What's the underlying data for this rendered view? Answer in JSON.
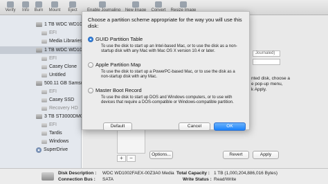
{
  "toolbar": {
    "items": [
      {
        "label": "Verify"
      },
      {
        "label": "Info"
      },
      {
        "label": "Burn"
      },
      {
        "label": "Mount"
      },
      {
        "label": "Eject"
      },
      {
        "label": "Enable Journaling"
      },
      {
        "label": "New Image"
      },
      {
        "label": "Convert"
      },
      {
        "label": "Resize Image"
      }
    ]
  },
  "sidebar": {
    "items": [
      {
        "label": "1 TB WDC WD100",
        "kind": "disk"
      },
      {
        "label": "EFI",
        "kind": "volume",
        "dim": true
      },
      {
        "label": "Media Libraries",
        "kind": "volume"
      },
      {
        "label": "1 TB WDC WD100",
        "kind": "disk",
        "selected": true
      },
      {
        "label": "EFI",
        "kind": "volume",
        "dim": true
      },
      {
        "label": "Casey Clone",
        "kind": "volume"
      },
      {
        "label": "Untitled",
        "kind": "volume"
      },
      {
        "label": "500.11 GB Samsu",
        "kind": "disk"
      },
      {
        "label": "EFI",
        "kind": "volume",
        "dim": true
      },
      {
        "label": "Casey SSD",
        "kind": "volume"
      },
      {
        "label": "Recovery HD",
        "kind": "volume",
        "dim": true
      },
      {
        "label": "3 TB ST3000DM00",
        "kind": "disk"
      },
      {
        "label": "EFI",
        "kind": "volume",
        "dim": true
      },
      {
        "label": "Tardis",
        "kind": "volume"
      },
      {
        "label": "Windows",
        "kind": "volume"
      },
      {
        "label": "SuperDrive",
        "kind": "optical"
      }
    ]
  },
  "main": {
    "format_field": "Journaled)",
    "side_text": [
      "nted disk, choose a",
      "e pop-up menu,",
      "k Apply."
    ],
    "add_label": "+",
    "remove_label": "−",
    "options_button": "Options...",
    "revert_button": "Revert",
    "apply_button": "Apply"
  },
  "dialog": {
    "prompt": "Choose a partition scheme appropriate for the way you will use this disk:",
    "options": [
      {
        "title": "GUID Partition Table",
        "selected": true,
        "desc": "To use the disk to start up an Intel-based Mac, or to use the disk as a non-startup disk with any Mac with Mac OS X version 10.4 or later."
      },
      {
        "title": "Apple Partition Map",
        "selected": false,
        "desc": "To use the disk to start up a PowerPC-based Mac, or to use the disk as a non-startup disk with any Mac."
      },
      {
        "title": "Master Boot Record",
        "selected": false,
        "desc": "To use the disk to start up DOS and Windows computers, or to use with devices that require a DOS-compatible or Windows-compatible partition."
      }
    ],
    "default_button": "Default",
    "cancel_button": "Cancel",
    "ok_button": "OK"
  },
  "status": {
    "disk_description_label": "Disk Description :",
    "disk_description_value": "WDC WD1002FAEX-00Z3A0 Media",
    "connection_bus_label": "Connection Bus :",
    "connection_bus_value": "SATA",
    "total_capacity_label": "Total Capacity :",
    "total_capacity_value": "1 TB (1,000,204,886,016 Bytes)",
    "write_status_label": "Write Status :",
    "write_status_value": "Read/Write"
  }
}
